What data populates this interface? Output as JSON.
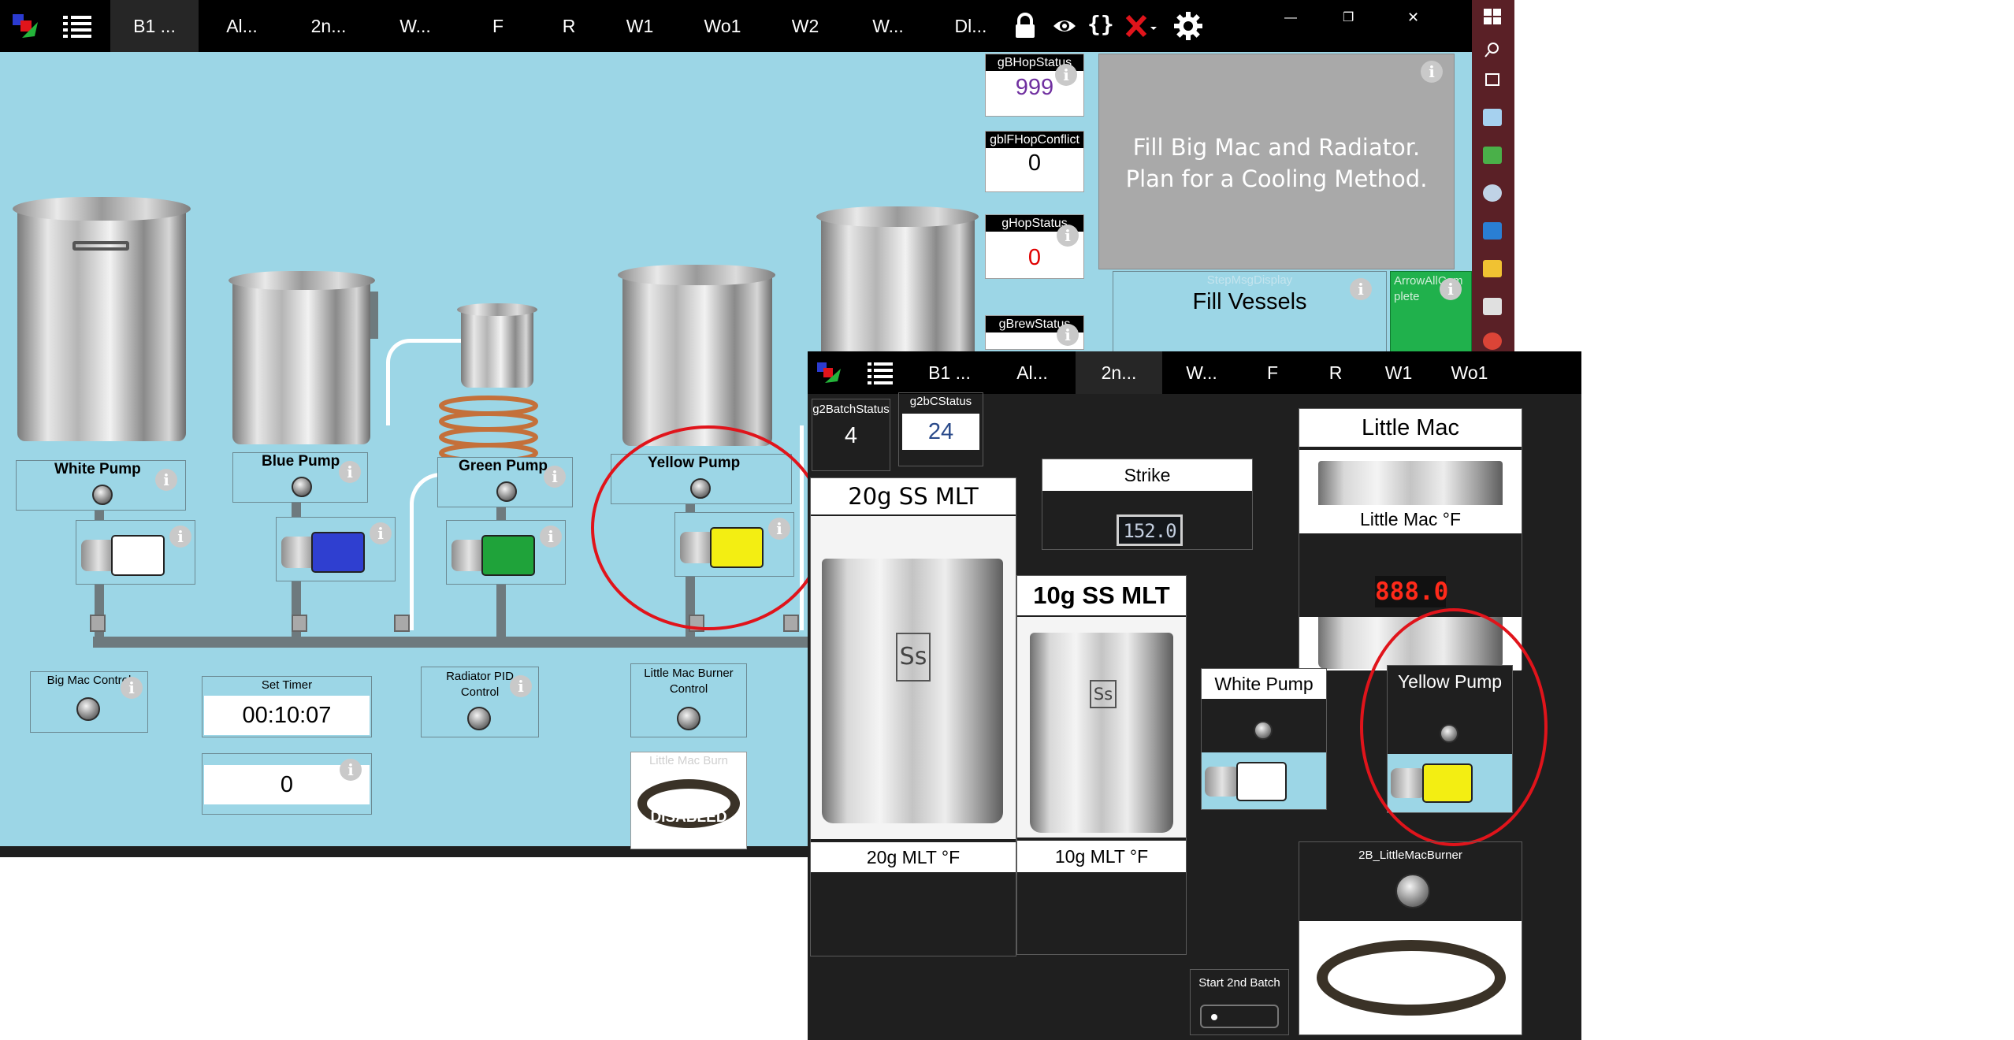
{
  "main_window": {
    "tabs": [
      "B1 ...",
      "Al...",
      "2n...",
      "W...",
      "F",
      "R",
      "W1",
      "Wo1",
      "W2",
      "W...",
      "Dl..."
    ],
    "active_tab_index": 0,
    "toolbar_icons": [
      "lock-icon",
      "eye-icon",
      "braces-icon",
      "close-x-icon",
      "gear-icon"
    ],
    "toolbar_braces_text": "{}",
    "window_controls": [
      "minimize-icon",
      "restore-icon",
      "close-icon"
    ],
    "minimize_glyph": "—",
    "restore_glyph": "❐",
    "close_glyph": "✕",
    "pumps": [
      {
        "name": "White Pump",
        "color": "#ffffff"
      },
      {
        "name": "Blue Pump",
        "color": "#2f3fd0"
      },
      {
        "name": "Green Pump",
        "color": "#1fa33a"
      },
      {
        "name": "Yellow Pump",
        "color": "#f3ee12"
      }
    ],
    "controls": {
      "big_mac_control": "Big Mac Control",
      "set_timer_label": "Set Timer",
      "set_timer_value": "00:10:07",
      "counter_value": "0",
      "radiator_pid": "Radiator PID Control",
      "little_mac_burner_control": "Little Mac Burner Control",
      "little_mac_burner_img_label": "Little Mac Burn",
      "disabled_text": "DISABLED"
    },
    "variables": [
      {
        "name": "gBHopStatus",
        "value": "999",
        "color": "#7030a0"
      },
      {
        "name": "gblFHopConflict",
        "value": "0",
        "color": "#000000"
      },
      {
        "name": "gHopStatus",
        "value": "0",
        "color": "#e00000"
      },
      {
        "name": "gBrewStatus",
        "value": "",
        "color": "#000000"
      }
    ],
    "instruction_text": "Fill Big Mac and Radiator.  Plan for a Cooling Method.",
    "step_display_label": "StepMsgDisplay",
    "step_text": "Fill Vessels",
    "arrow_button_label": "ArrowAllComplete"
  },
  "taskbar_icons": [
    "windows-icon",
    "search-icon",
    "task-view-icon",
    "notepad-icon",
    "editor-icon",
    "paint-icon",
    "visual-studio-icon",
    "file-explorer-icon",
    "photos-icon",
    "chrome-icon"
  ],
  "second_window": {
    "tabs": [
      "B1 ...",
      "Al...",
      "2n...",
      "W...",
      "F",
      "R",
      "W1",
      "Wo1"
    ],
    "active_tab_index": 2,
    "g2_batch_status_label": "g2BatchStatus",
    "g2_batch_status_value": "4",
    "g2bc_status_label": "g2bCStatus",
    "g2bc_status_value": "24",
    "strike_label": "Strike",
    "strike_value": "152.0",
    "mlt20_title": "20g SS MLT",
    "mlt20_temp_label": "20g MLT  °F",
    "mlt10_title": "10g SS MLT",
    "mlt10_temp_label": "10g MLT  °F",
    "ss_logo_text": "Ss",
    "little_mac_title": "Little Mac",
    "little_mac_temp_label": "Little Mac °F",
    "little_mac_temp_value": "888.0",
    "white_pump_label": "White Pump",
    "yellow_pump_label": "Yellow Pump",
    "burner_label": "2B_LittleMacBurner",
    "start_2nd_batch_label": "Start 2nd Batch"
  }
}
